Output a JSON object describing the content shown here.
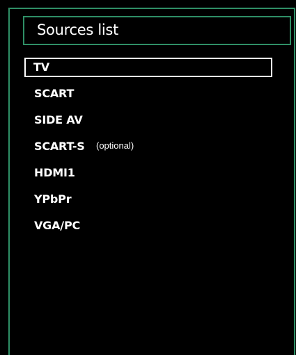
{
  "menu": {
    "title": "Sources list",
    "items": [
      {
        "label": "TV",
        "selected": true
      },
      {
        "label": "SCART",
        "selected": false
      },
      {
        "label": "SIDE AV",
        "selected": false
      },
      {
        "label": "SCART-S",
        "selected": false,
        "note": "(optional)"
      },
      {
        "label": "HDMI1",
        "selected": false
      },
      {
        "label": "YPbPr",
        "selected": false
      },
      {
        "label": "VGA/PC",
        "selected": false
      }
    ]
  },
  "colors": {
    "background": "#000000",
    "frame_accent": "#2f8f66",
    "text": "#ffffff",
    "selection_border": "#ffffff"
  }
}
